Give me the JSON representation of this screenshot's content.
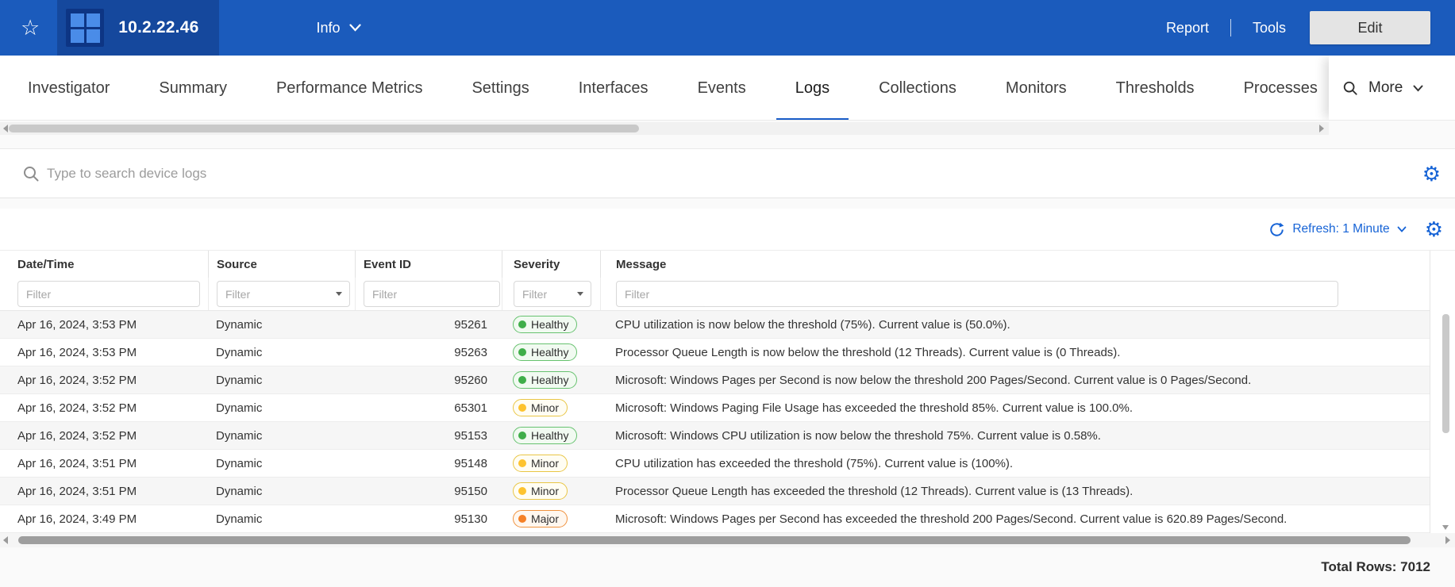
{
  "topbar": {
    "device_title": "10.2.22.46",
    "info_label": "Info",
    "report_label": "Report",
    "tools_label": "Tools",
    "edit_label": "Edit"
  },
  "tabs": {
    "items": [
      {
        "label": "Investigator",
        "active": false
      },
      {
        "label": "Summary",
        "active": false
      },
      {
        "label": "Performance Metrics",
        "active": false
      },
      {
        "label": "Settings",
        "active": false
      },
      {
        "label": "Interfaces",
        "active": false
      },
      {
        "label": "Events",
        "active": false
      },
      {
        "label": "Logs",
        "active": true
      },
      {
        "label": "Collections",
        "active": false
      },
      {
        "label": "Monitors",
        "active": false
      },
      {
        "label": "Thresholds",
        "active": false
      },
      {
        "label": "Processes",
        "active": false,
        "truncated": true
      }
    ],
    "more_label": "More"
  },
  "search": {
    "placeholder": "Type to search device logs"
  },
  "toolbar": {
    "refresh_label": "Refresh: 1 Minute"
  },
  "table": {
    "columns": [
      "Date/Time",
      "Source",
      "Event ID",
      "Severity",
      "Message"
    ],
    "filter_placeholder": "Filter",
    "rows": [
      {
        "datetime": "Apr 16, 2024, 3:53 PM",
        "source": "Dynamic",
        "event_id": "95261",
        "severity": "Healthy",
        "message": "CPU utilization is now below the threshold (75%). Current value is (50.0%)."
      },
      {
        "datetime": "Apr 16, 2024, 3:53 PM",
        "source": "Dynamic",
        "event_id": "95263",
        "severity": "Healthy",
        "message": "Processor Queue Length is now below the threshold (12 Threads). Current value is (0 Threads)."
      },
      {
        "datetime": "Apr 16, 2024, 3:52 PM",
        "source": "Dynamic",
        "event_id": "95260",
        "severity": "Healthy",
        "message": "Microsoft: Windows Pages per Second is now below the threshold 200 Pages/Second. Current value is 0 Pages/Second."
      },
      {
        "datetime": "Apr 16, 2024, 3:52 PM",
        "source": "Dynamic",
        "event_id": "65301",
        "severity": "Minor",
        "message": "Microsoft: Windows Paging File Usage has exceeded the threshold 85%. Current value is 100.0%."
      },
      {
        "datetime": "Apr 16, 2024, 3:52 PM",
        "source": "Dynamic",
        "event_id": "95153",
        "severity": "Healthy",
        "message": "Microsoft: Windows CPU utilization is now below the threshold 75%. Current value is 0.58%."
      },
      {
        "datetime": "Apr 16, 2024, 3:51 PM",
        "source": "Dynamic",
        "event_id": "95148",
        "severity": "Minor",
        "message": "CPU utilization has exceeded the threshold (75%). Current value is (100%)."
      },
      {
        "datetime": "Apr 16, 2024, 3:51 PM",
        "source": "Dynamic",
        "event_id": "95150",
        "severity": "Minor",
        "message": "Processor Queue Length has exceeded the threshold (12 Threads). Current value is (13 Threads)."
      },
      {
        "datetime": "Apr 16, 2024, 3:49 PM",
        "source": "Dynamic",
        "event_id": "95130",
        "severity": "Major",
        "message": "Microsoft: Windows Pages per Second has exceeded the threshold 200 Pages/Second. Current value is 620.89 Pages/Second."
      }
    ]
  },
  "footer": {
    "total_rows": "Total Rows: 7012"
  },
  "colors": {
    "accent_blue": "#1663d6",
    "topbar_blue": "#1b5bbc",
    "active_tab_underline": "#1a5dc8",
    "severity": {
      "Healthy": {
        "dot": "#3fae49",
        "border": "#67c26f",
        "bg": "#f1faf1"
      },
      "Minor": {
        "dot": "#fdc32f",
        "border": "#e9c646",
        "bg": "#fffdf3"
      },
      "Major": {
        "dot": "#f58025",
        "border": "#f0923e",
        "bg": "#fff7ef"
      }
    }
  }
}
